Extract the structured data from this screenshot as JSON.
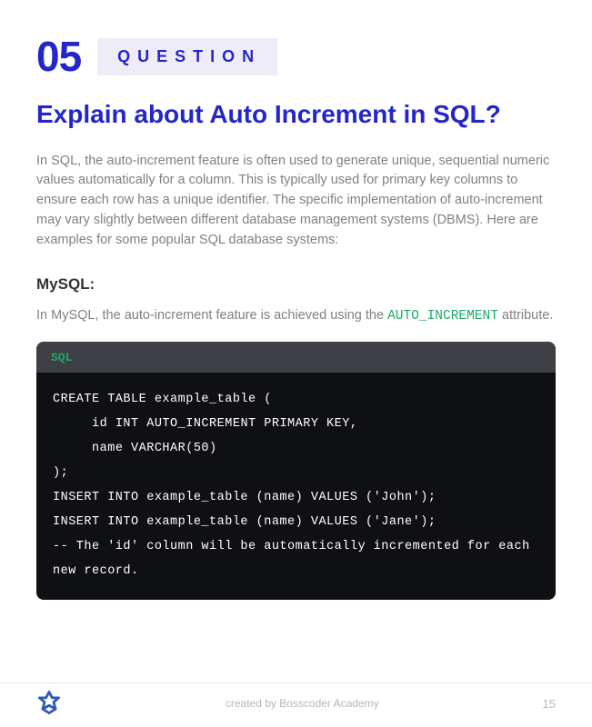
{
  "header": {
    "number": "05",
    "badge": "QUESTION"
  },
  "title": "Explain about Auto Increment in SQL?",
  "intro": "In SQL, the auto-increment feature is often used to generate unique, sequential numeric values automatically for a column. This is typically used for primary key columns to ensure each row has a unique identifier. The specific implementation of auto-increment may vary slightly between different database management systems (DBMS). Here are examples for some popular SQL database systems:",
  "section": {
    "heading": "MySQL:",
    "desc_pre": "In MySQL, the auto-increment feature is achieved using the ",
    "keyword": "AUTO_INCREMENT",
    "desc_post": " attribute."
  },
  "code": {
    "lang": "SQL",
    "body": "CREATE TABLE example_table (\n     id INT AUTO_INCREMENT PRIMARY KEY,\n     name VARCHAR(50)\n);\nINSERT INTO example_table (name) VALUES ('John');\nINSERT INTO example_table (name) VALUES ('Jane');\n-- The 'id' column will be automatically incremented for each new record."
  },
  "footer": {
    "credit": "created by Bosscoder Academy",
    "page_number": "15"
  }
}
